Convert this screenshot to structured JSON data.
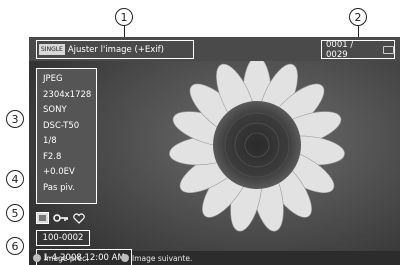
{
  "header": {
    "mode_badge": "SINGLE",
    "mode_label": "Ajuster l'image (+Exif)",
    "image_counter": "0001 / 0029",
    "card_icon": "memory-card-icon"
  },
  "exif": [
    "JPEG",
    "2304x1728",
    "SONY",
    "DSC-T50",
    "1/8",
    "F2.8",
    "+0.0EV",
    "Pas piv."
  ],
  "status_icons": [
    "protect-icon",
    "key-icon",
    "heart-icon"
  ],
  "folder_number": "100-0002",
  "datetime": "1-4-2008 12:00 AM",
  "footer": {
    "prev_label": "Image préc.",
    "next_label": "Image suivante."
  },
  "callouts": [
    "1",
    "2",
    "3",
    "4",
    "5",
    "6"
  ],
  "colors": {
    "panel": "#555555",
    "border": "#ffffff",
    "background": "#3a3a3a"
  }
}
